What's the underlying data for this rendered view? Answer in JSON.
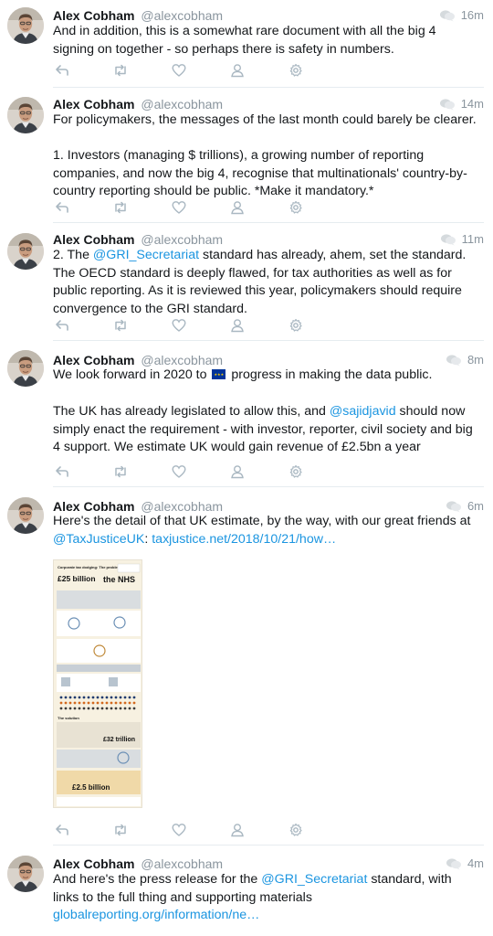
{
  "author": {
    "name": "Alex Cobham",
    "handle": "@alexcobham"
  },
  "icons": {
    "reply": "reply-icon",
    "retweet": "retweet-icon",
    "like": "heart-icon",
    "follow": "user-icon",
    "more": "gear-icon",
    "conversation": "speech-bubble-icon"
  },
  "colors": {
    "link": "#1b95e0",
    "muted": "#8a959e",
    "divider": "#e6ecf0",
    "text": "#14171a"
  },
  "tweets": [
    {
      "time": "16m",
      "text": [
        "And in addition, this is a somewhat rare document with all the big 4 signing on together - so perhaps there is safety in numbers."
      ]
    },
    {
      "time": "14m",
      "text": [
        "For policymakers, the messages of the last month could barely be clearer.",
        "1. Investors (managing $ trillions), a growing number of reporting companies, and now the big 4, recognise that multinationals' country-by-country reporting should be public. *Make it mandatory.*"
      ]
    },
    {
      "time": "11m",
      "pre": "2. The ",
      "mention": "@GRI_Secretariat",
      "post": " standard has already, ahem, set the standard. The OECD standard is deeply flawed, for tax authorities as well as for public reporting. As it is reviewed this year, policymakers should require convergence to the GRI standard."
    },
    {
      "time": "8m",
      "line1_pre": "We look forward in 2020 to ",
      "line1_post": " progress in making the data public.",
      "p2_pre": "The UK has already legislated to allow this, and ",
      "p2_mention": "@sajidjavid",
      "p2_post": " should now simply enact the requirement - with investor, reporter, civil society and big 4 support. We estimate UK would gain revenue of £2.5bn a year"
    },
    {
      "time": "6m",
      "pre": "Here's the detail of that UK estimate, by the way, with our great friends at ",
      "mention": "@TaxJusticeUK",
      "mid": ": ",
      "link": "taxjustice.net/2018/10/21/how…",
      "infographic": {
        "heading": "Corporate tax dodging: The problem",
        "amount1": "£25 billion",
        "label1": "the NHS",
        "amount2": "£32 trillion",
        "solution": "The solution",
        "amount3": "£2.5 billion"
      }
    },
    {
      "time": "4m",
      "pre": "And here's the press release for the ",
      "mention": "@GRI_Secretariat",
      "mid": " standard, with links to the full thing and supporting materials ",
      "link": "globalreporting.org/information/ne…"
    }
  ]
}
